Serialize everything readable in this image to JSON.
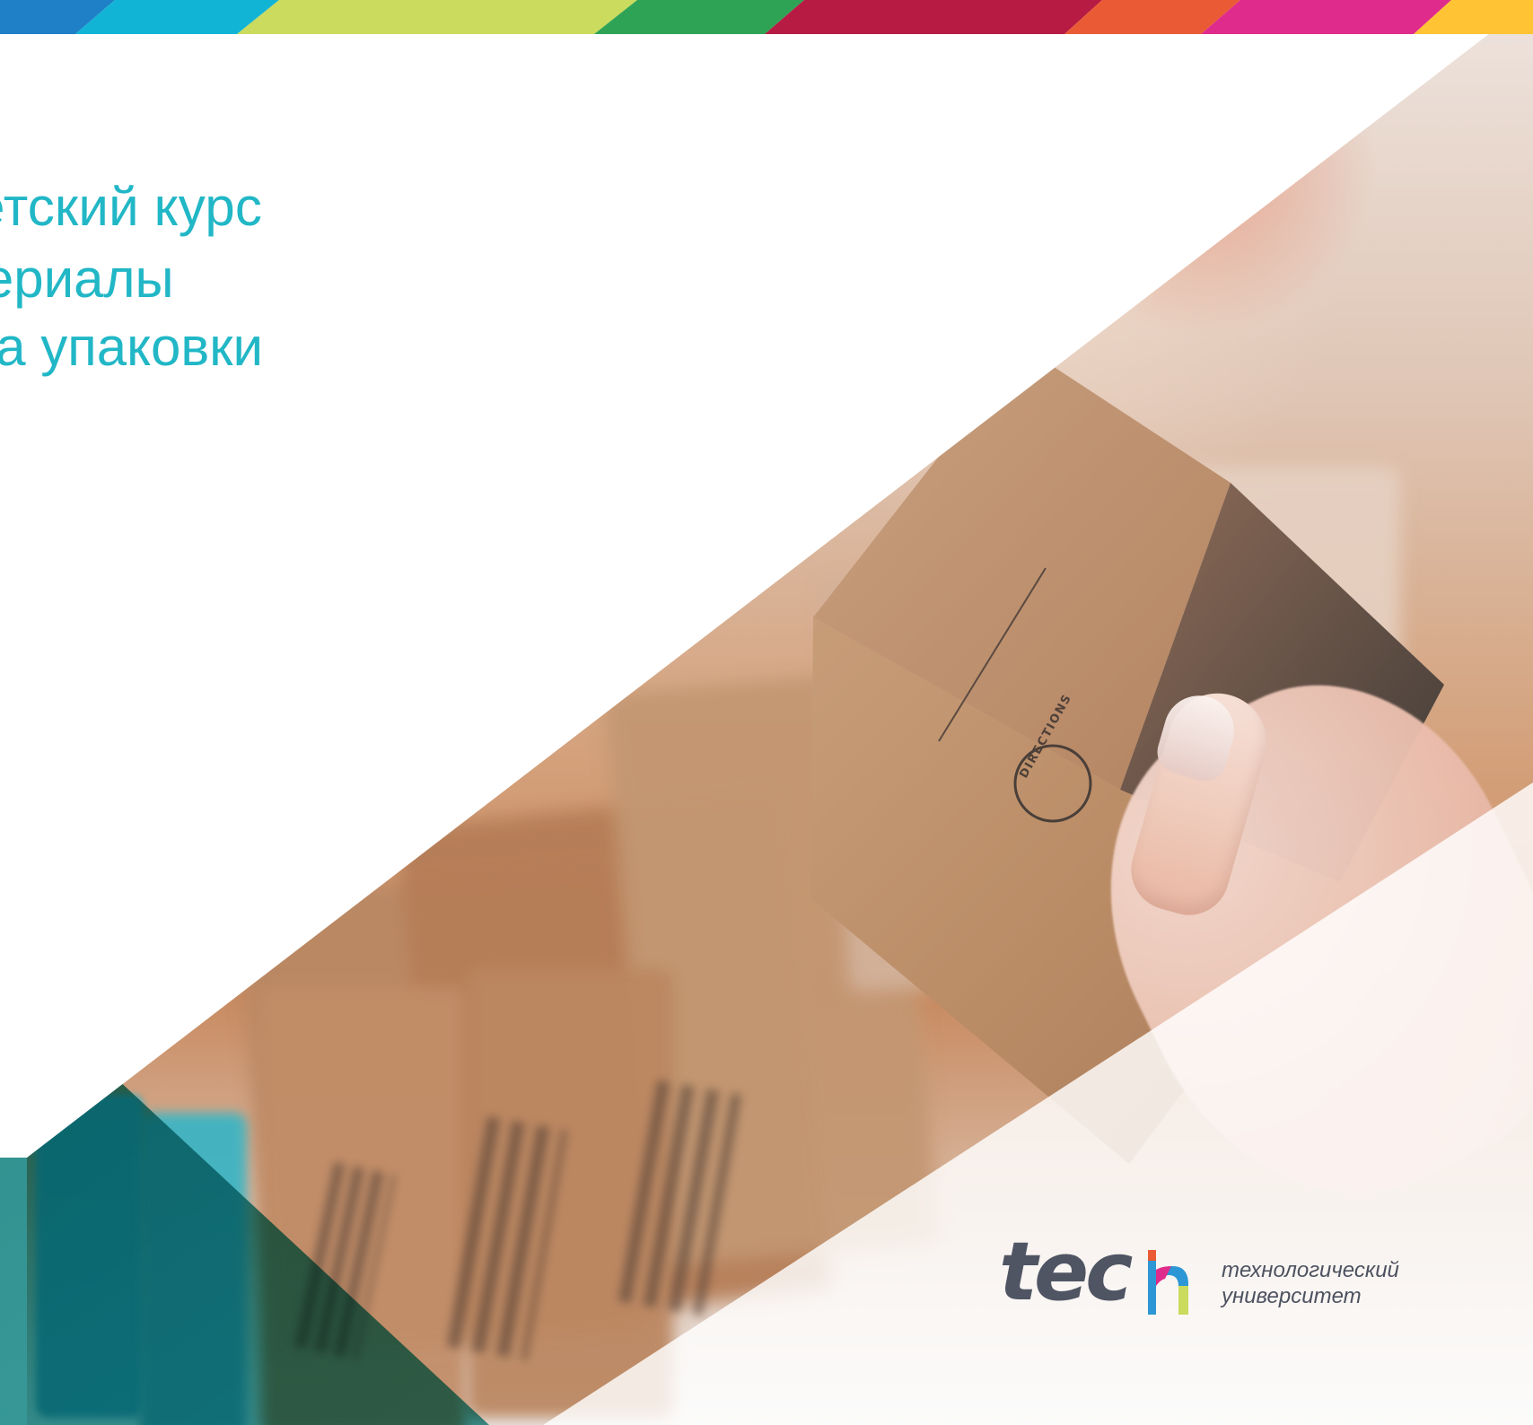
{
  "title": {
    "line1": "Университетский курс",
    "line2": "Новые материалы",
    "line3": "для дизайна упаковки"
  },
  "branding": {
    "wordmark": "tech",
    "descriptor_line1": "технологический",
    "descriptor_line2": "университет"
  },
  "photo": {
    "box_text": "DIRECTIONS"
  },
  "colors": {
    "title": "#21b7c6",
    "logo_text": "#4f5563",
    "teal": "#11777a",
    "strip": [
      "#1f80c7",
      "#12b4d6",
      "#cadb5e",
      "#2ea356",
      "#b71b43",
      "#ea5b35",
      "#df2b8b",
      "#ffc333"
    ]
  }
}
